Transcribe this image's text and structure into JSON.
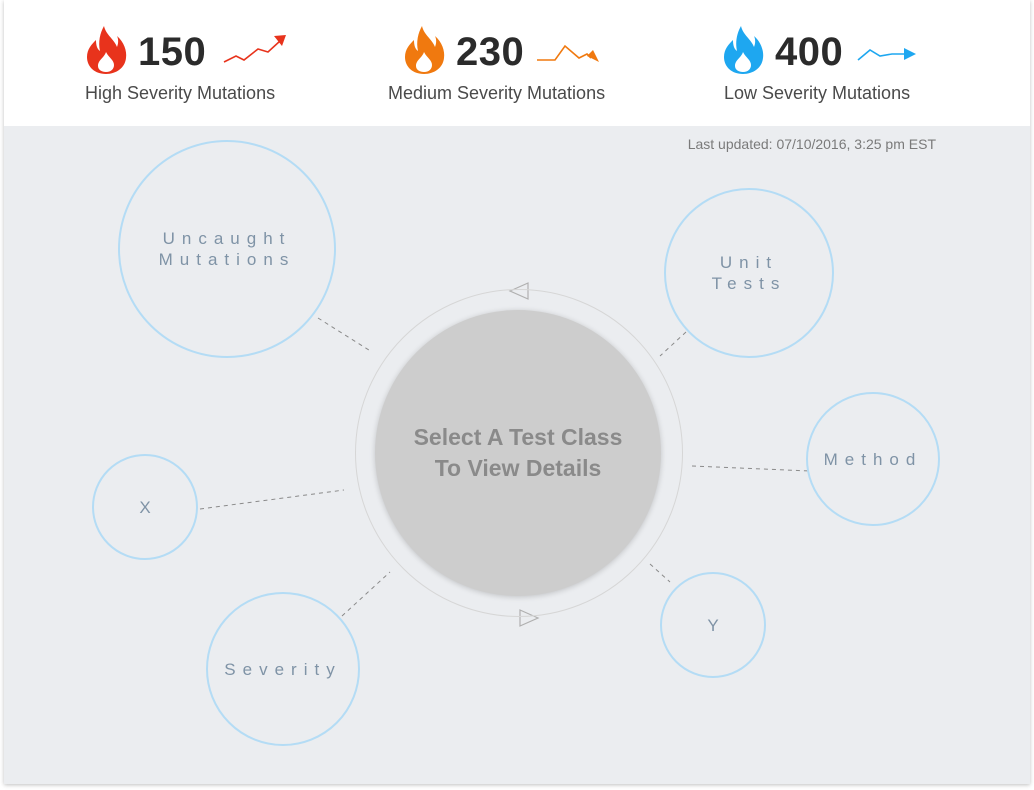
{
  "stats": [
    {
      "count": "150",
      "label": "High Severity Mutations",
      "color": "#e8331c",
      "trend_color": "#e8331c",
      "icon": "fire-icon",
      "trend_icon": "trend-up-icon"
    },
    {
      "count": "230",
      "label": "Medium Severity Mutations",
      "color": "#f0790f",
      "trend_color": "#f0790f",
      "icon": "fire-icon",
      "trend_icon": "trend-down-icon"
    },
    {
      "count": "400",
      "label": "Low Severity Mutations",
      "color": "#1ea7f0",
      "trend_color": "#1ea7f0",
      "icon": "fire-icon",
      "trend_icon": "trend-flat-up-icon"
    }
  ],
  "last_updated": "Last updated: 07/10/2016, 3:25 pm EST",
  "center": {
    "line1": "Select A Test Class",
    "line2": "To View Details"
  },
  "nodes": {
    "uncaught_1": "Uncaught",
    "uncaught_2": "Mutations",
    "unit_1": "Unit",
    "unit_2": "Tests",
    "method": "Method",
    "x": "X",
    "y": "Y",
    "severity": "Severity"
  },
  "colors": {
    "node_border": "#b4dcf5",
    "background": "#ebedf0",
    "center_disc": "#cdcdcd"
  }
}
